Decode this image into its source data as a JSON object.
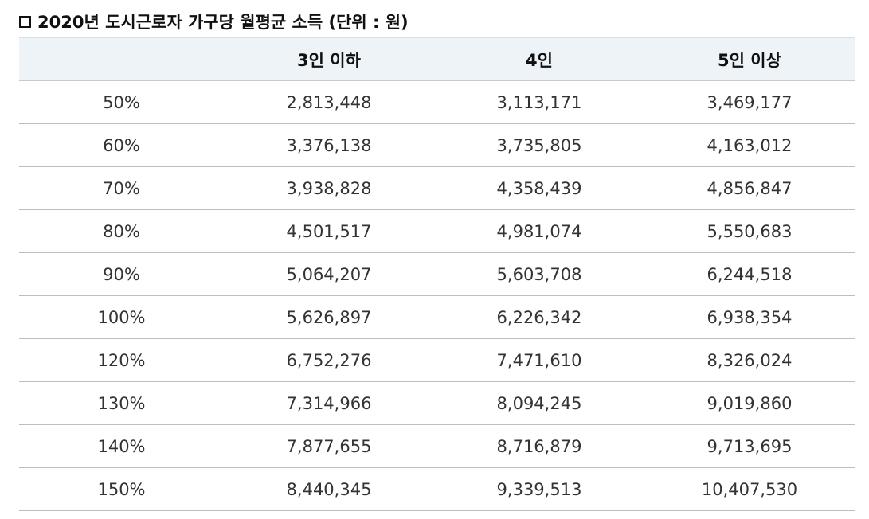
{
  "title": {
    "checkbox_glyph": "☐",
    "text": "2020년 도시근로자 가구당 월평균 소득  (단위 : 원)"
  },
  "table": {
    "headers": [
      "",
      "3인 이하",
      "4인",
      "5인 이상"
    ],
    "rows": [
      [
        "50%",
        "2,813,448",
        "3,113,171",
        "3,469,177"
      ],
      [
        "60%",
        "3,376,138",
        "3,735,805",
        "4,163,012"
      ],
      [
        "70%",
        "3,938,828",
        "4,358,439",
        "4,856,847"
      ],
      [
        "80%",
        "4,501,517",
        "4,981,074",
        "5,550,683"
      ],
      [
        "90%",
        "5,064,207",
        "5,603,708",
        "6,244,518"
      ],
      [
        "100%",
        "5,626,897",
        "6,226,342",
        "6,938,354"
      ],
      [
        "120%",
        "6,752,276",
        "7,471,610",
        "8,326,024"
      ],
      [
        "130%",
        "7,314,966",
        "8,094,245",
        "9,019,860"
      ],
      [
        "140%",
        "7,877,655",
        "8,716,879",
        "9,713,695"
      ],
      [
        "150%",
        "8,440,345",
        "9,339,513",
        "10,407,530"
      ]
    ]
  },
  "colors": {
    "header_background": "#eef3f8",
    "row_divider": "#bdbdbd",
    "text": "#333333"
  }
}
